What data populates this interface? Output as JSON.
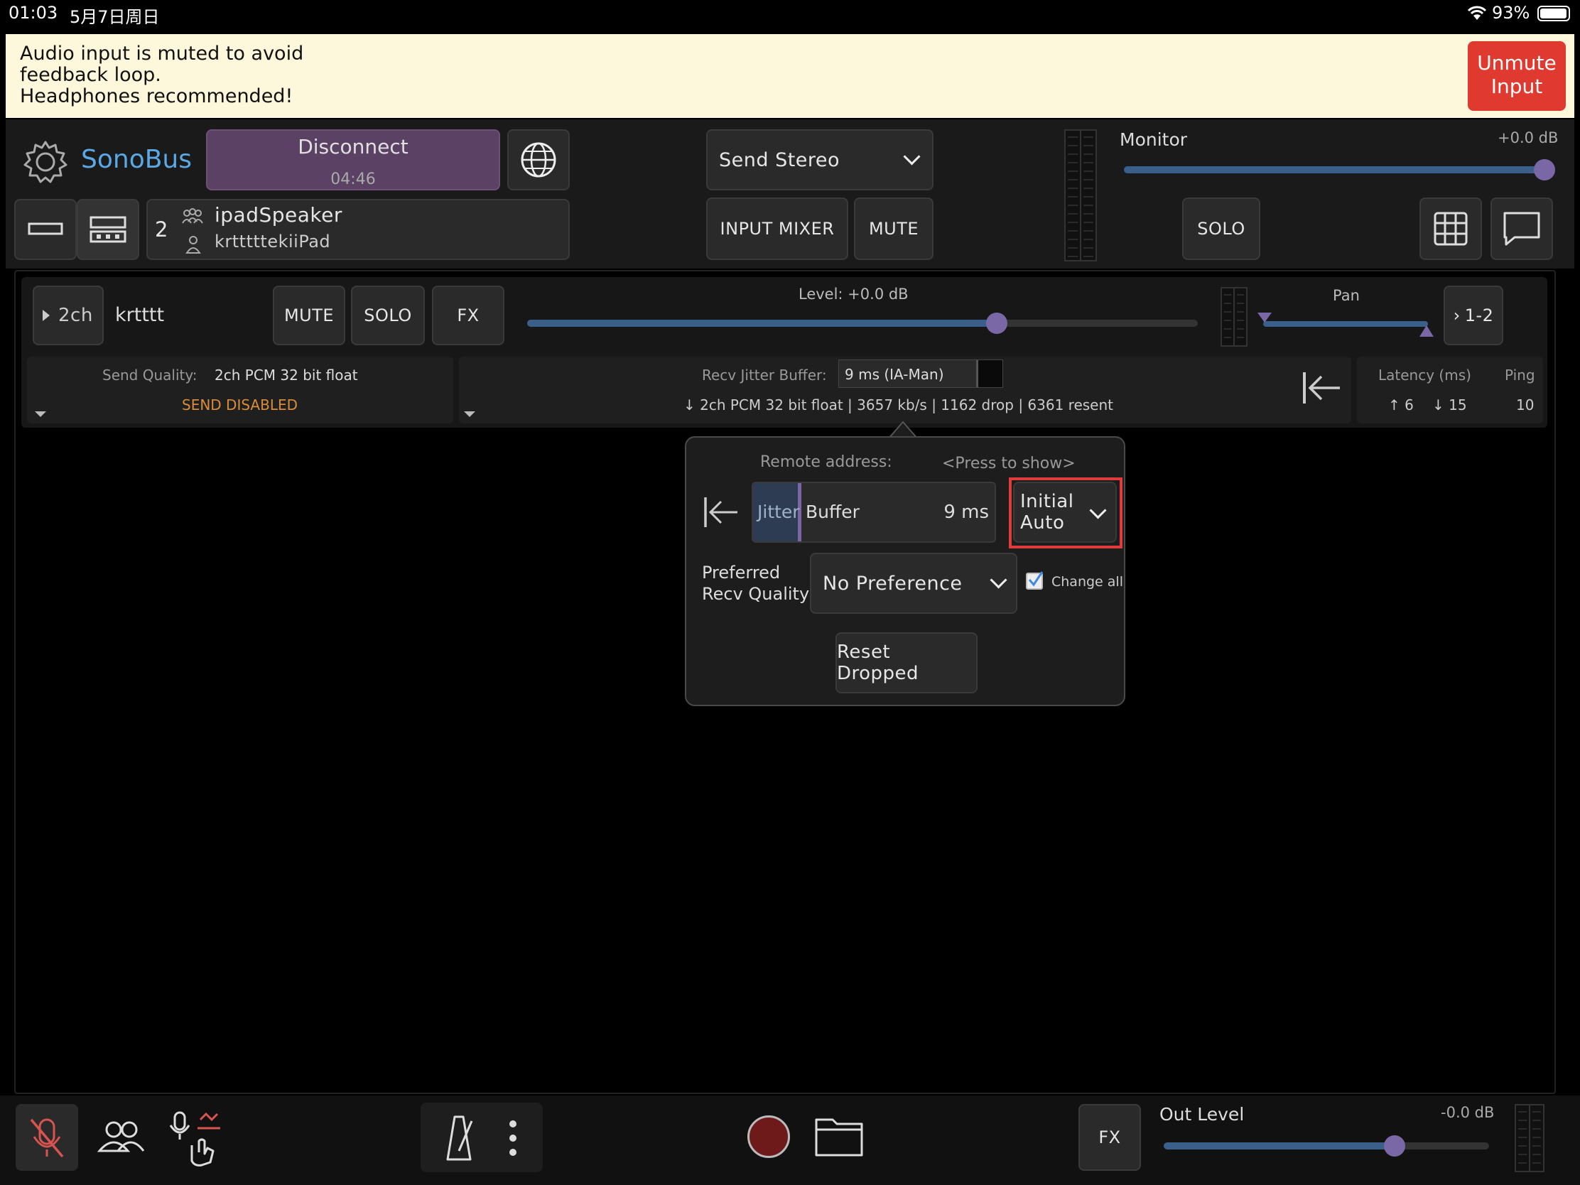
{
  "status_bar": {
    "time": "01:03",
    "date": "5月7日周日",
    "battery": "93%"
  },
  "banner": {
    "line1": "Audio input is muted to avoid",
    "line2": "feedback loop.",
    "line3": "Headphones recommended!",
    "unmute_line1": "Unmute",
    "unmute_line2": "Input"
  },
  "header": {
    "app_name": "SonoBus",
    "disconnect": "Disconnect",
    "elapsed": "04:46",
    "send_mode": "Send Stereo",
    "input_mixer": "INPUT MIXER",
    "mute": "MUTE",
    "monitor_label": "Monitor",
    "monitor_db": "+0.0 dB",
    "monitor_level": 1.0,
    "solo": "SOLO",
    "group_count": "2",
    "group_name": "ipadSpeaker",
    "user_name": "krtttttekiiPad"
  },
  "peer": {
    "channels": "2ch",
    "name": "krtttt",
    "mute": "MUTE",
    "solo": "SOLO",
    "fx": "FX",
    "level_label": "Level: +0.0 dB",
    "level": 0.7,
    "pan_label": "Pan",
    "output": "1-2",
    "send_quality_label": "Send Quality:",
    "send_quality": "2ch PCM 32 bit float",
    "send_disabled": "SEND DISABLED",
    "jitter_label": "Recv Jitter Buffer:",
    "jitter_value": "9 ms (IA-Man)",
    "recv_stats": "↓ 2ch PCM 32 bit float | 3657 kb/s | 1162 drop | 6361 resent",
    "latency_label": "Latency (ms)",
    "ping_label": "Ping",
    "latency_up": "↑ 6",
    "latency_down": "↓ 15",
    "ping": "10"
  },
  "popup": {
    "remote_label": "Remote address:",
    "press_to_show": "<Press to show>",
    "jitter_word1": "Jitter",
    "jitter_word2": "Buffer",
    "jitter_ms": "9 ms",
    "buffer_mode_line1": "Initial",
    "buffer_mode_line2": "Auto",
    "preferred_line1": "Preferred",
    "preferred_line2": "Recv Quality",
    "preference": "No Preference",
    "change_all": "Change all",
    "reset_dropped": "Reset Dropped"
  },
  "footer": {
    "fx": "FX",
    "out_level_label": "Out Level",
    "out_level_db": "-0.0 dB",
    "out_level": 0.71
  },
  "colors": {
    "accent": "#5aa8e6",
    "purple": "#5b4163",
    "highlight": "#e03c3c",
    "send_disabled": "#d98c3a",
    "unmute": "#e0392f"
  }
}
